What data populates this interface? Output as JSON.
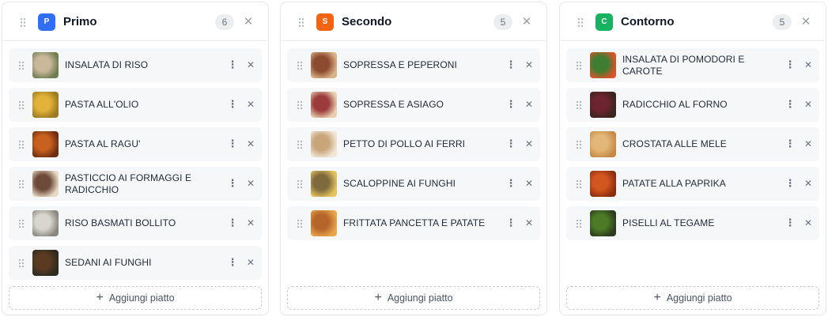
{
  "columns": [
    {
      "badge": "P",
      "title": "Primo",
      "count": "6",
      "color": "#2f6ef5",
      "close_icon": "close-icon",
      "items": [
        {
          "label": "INSALATA DI RISO",
          "thumb": [
            "#c9b89a",
            "#6f7d52"
          ]
        },
        {
          "label": "PASTA ALL'OLIO",
          "thumb": [
            "#e2b23a",
            "#9a7a22"
          ]
        },
        {
          "label": "PASTA AL RAGU'",
          "thumb": [
            "#c8601f",
            "#6e2e12"
          ]
        },
        {
          "label": "PASTICCIO AI FORMAGGI E RADICCHIO",
          "thumb": [
            "#6e4a3a",
            "#e7d9c4"
          ]
        },
        {
          "label": "RISO BASMATI BOLLITO",
          "thumb": [
            "#d8d6cf",
            "#8a8780"
          ]
        },
        {
          "label": "SEDANI AI FUNGHI",
          "thumb": [
            "#5a3b22",
            "#2b2a1f"
          ]
        }
      ],
      "add_label": "Aggiungi piatto"
    },
    {
      "badge": "S",
      "title": "Secondo",
      "count": "5",
      "color": "#f26411",
      "close_icon": "close-icon",
      "items": [
        {
          "label": "SOPRESSA E PEPERONI",
          "thumb": [
            "#8c4a2e",
            "#d9b48a"
          ]
        },
        {
          "label": "SOPRESSA E ASIAGO",
          "thumb": [
            "#9b3b3b",
            "#e8cfb0"
          ]
        },
        {
          "label": "PETTO DI POLLO AI FERRI",
          "thumb": [
            "#c9a57a",
            "#f0e6d6"
          ]
        },
        {
          "label": "SCALOPPINE AI FUNGHI",
          "thumb": [
            "#7f6a3e",
            "#e4c45f"
          ]
        },
        {
          "label": "FRITTATA PANCETTA E PATATE",
          "thumb": [
            "#b5652a",
            "#e9a64a"
          ]
        }
      ],
      "add_label": "Aggiungi piatto"
    },
    {
      "badge": "C",
      "title": "Contorno",
      "count": "5",
      "color": "#17b360",
      "close_icon": "close-icon",
      "items": [
        {
          "label": "INSALATA DI POMODORI E CAROTE",
          "thumb": [
            "#3f7d32",
            "#d9532b"
          ]
        },
        {
          "label": "RADICCHIO AL FORNO",
          "thumb": [
            "#6b2430",
            "#3a2520"
          ]
        },
        {
          "label": "CROSTATA ALLE MELE",
          "thumb": [
            "#e3b779",
            "#c58a45"
          ]
        },
        {
          "label": "PATATE ALLA PAPRIKA",
          "thumb": [
            "#d2561f",
            "#8c2e10"
          ]
        },
        {
          "label": "PISELLI AL TEGAME",
          "thumb": [
            "#4c7a26",
            "#2c3a1e"
          ]
        }
      ],
      "add_label": "Aggiungi piatto"
    }
  ]
}
